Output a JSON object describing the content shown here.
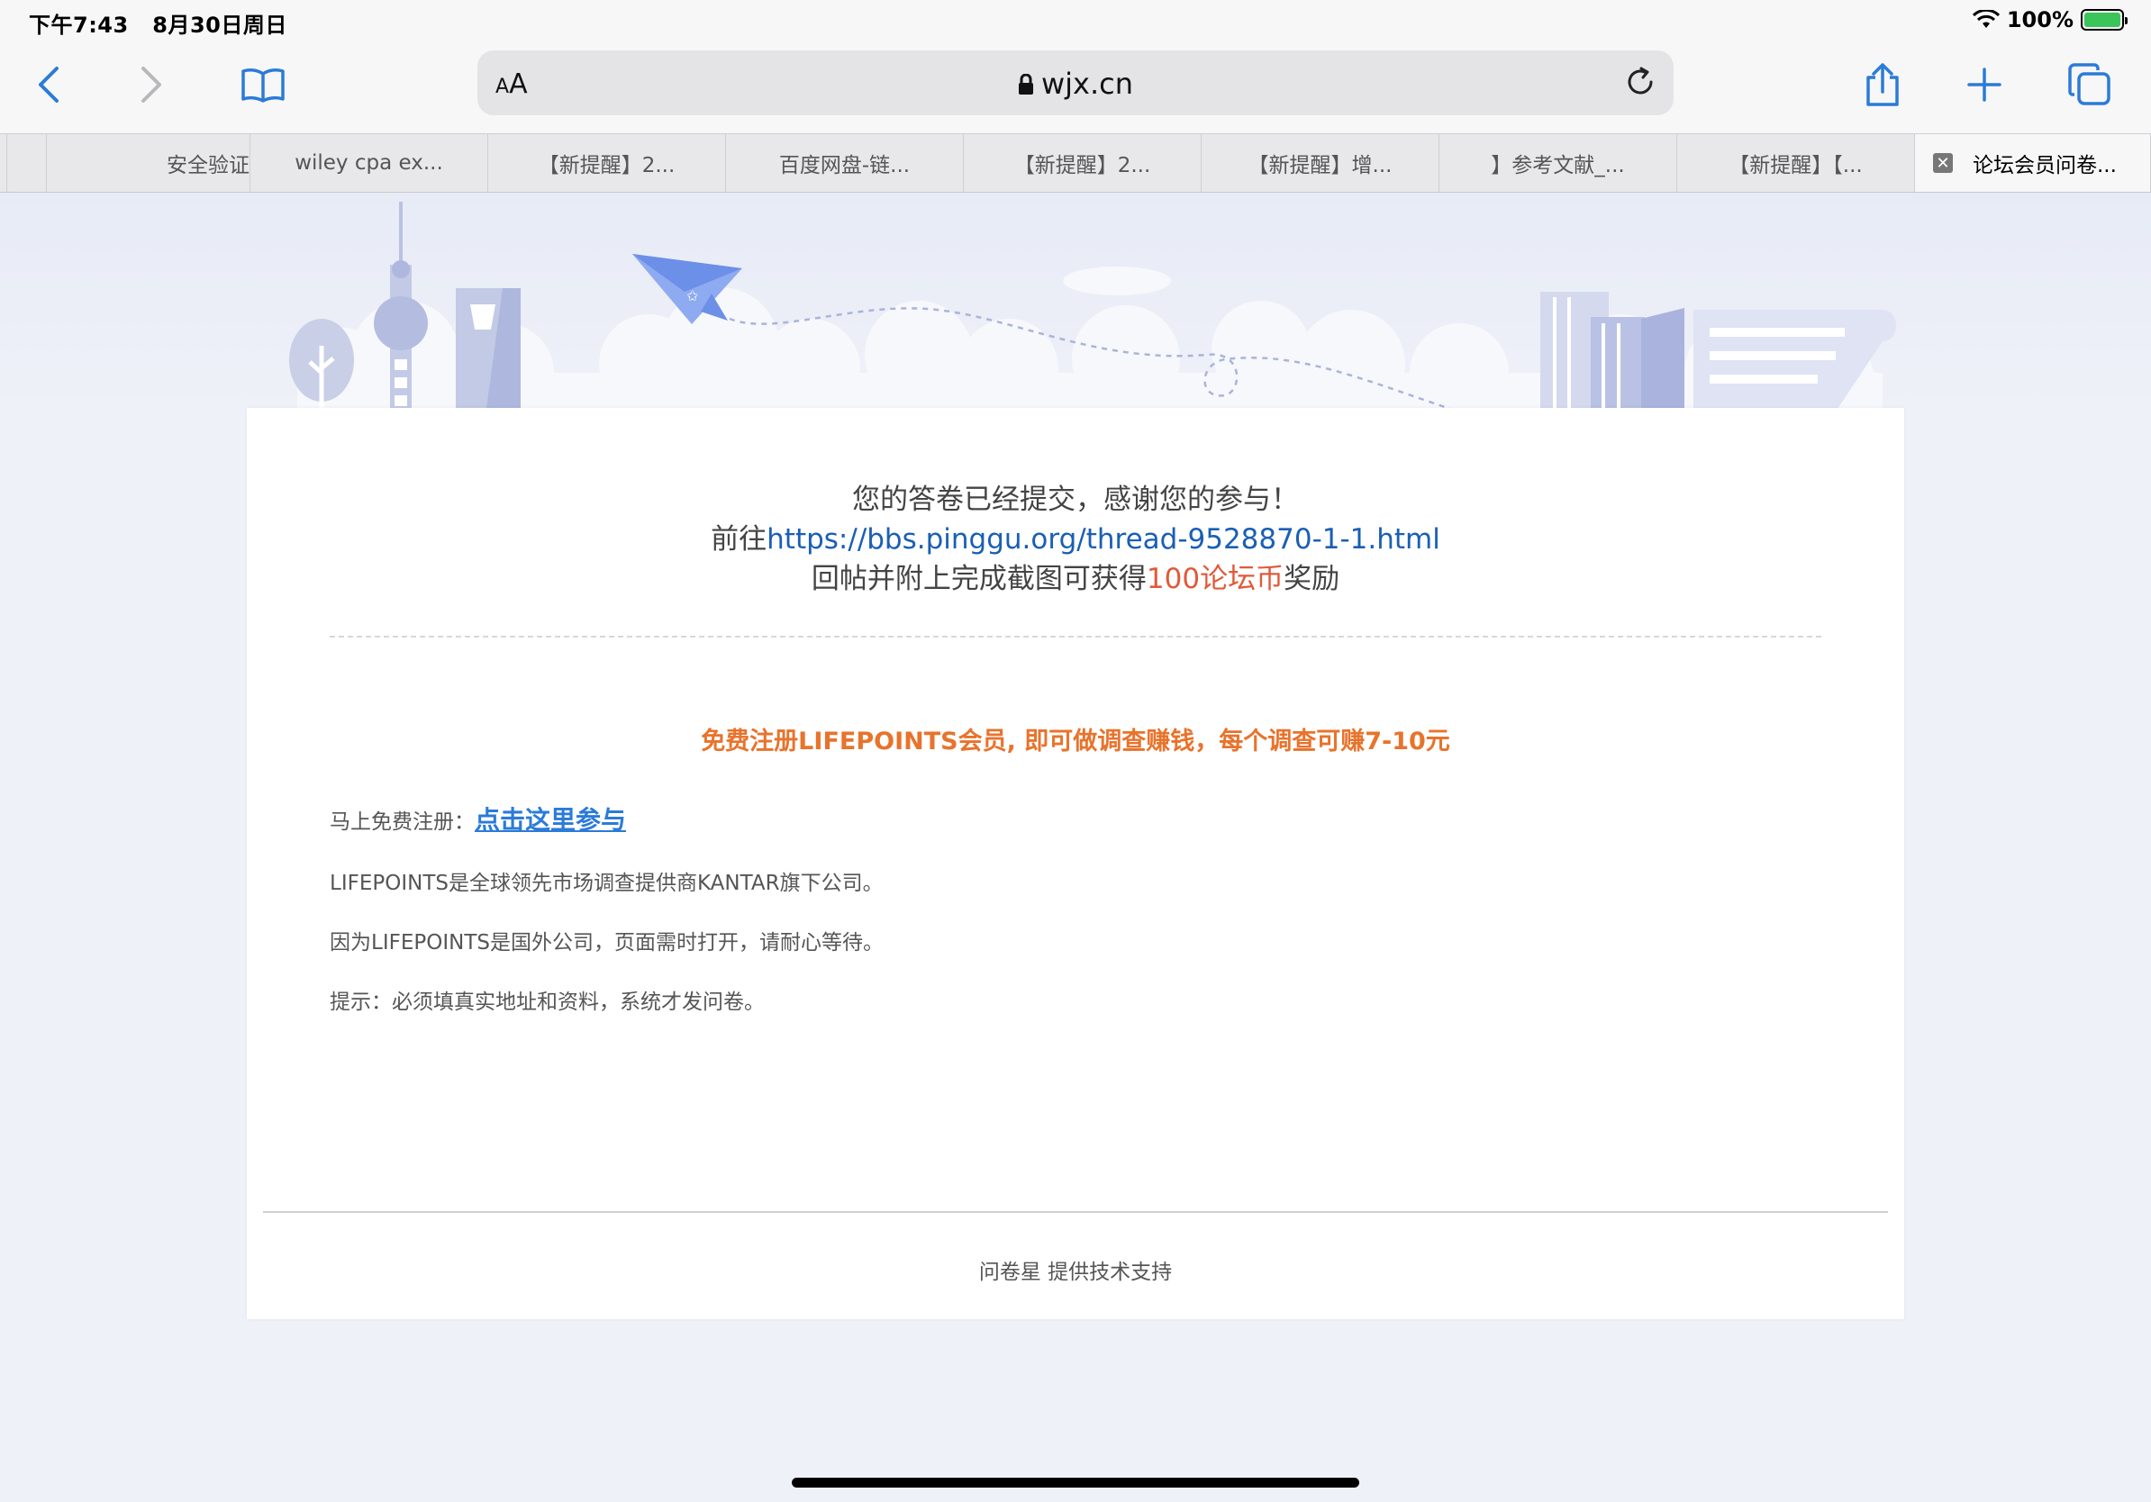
{
  "status": {
    "time": "下午7:43",
    "date": "8月30日周日",
    "battery": "100%"
  },
  "toolbar": {
    "aa_small": "A",
    "aa_large": "A",
    "url": "wjx.cn"
  },
  "tabs": [
    {
      "label": ""
    },
    {
      "label": ""
    },
    {
      "label": "安全验证"
    },
    {
      "label": "wiley cpa ex..."
    },
    {
      "label": "【新提醒】2..."
    },
    {
      "label": "百度网盘-链..."
    },
    {
      "label": "【新提醒】2..."
    },
    {
      "label": "【新提醒】增..."
    },
    {
      "label": "】参考文献_..."
    },
    {
      "label": "【新提醒】【..."
    },
    {
      "label": "论坛会员问卷...",
      "close": "✕"
    }
  ],
  "message": {
    "line1": "您的答卷已经提交，感谢您的参与！",
    "line2_prefix": "前往",
    "line2_link": "https://bbs.pinggu.org/thread-9528870-1-1.html",
    "line3_prefix": "回帖并附上完成截图可获得",
    "line3_highlight": "100论坛币",
    "line3_suffix": "奖励"
  },
  "promo": "免费注册LIFEPOINTS会员, 即可做调查赚钱，每个调查可赚7-10元",
  "register": {
    "label": "马上免费注册：",
    "link": "点击这里参与"
  },
  "info": [
    "LIFEPOINTS是全球领先市场调查提供商KANTAR旗下公司。",
    "因为LIFEPOINTS是国外公司，页面需时打开，请耐心等待。",
    "提示：必须填真实地址和资料，系统才发问卷。"
  ],
  "footer": "问卷星 提供技术支持",
  "colors": {
    "accent": "#2b7bd8",
    "promo": "#e8732c",
    "reward": "#e05a3a",
    "link": "#1a5fb4"
  }
}
